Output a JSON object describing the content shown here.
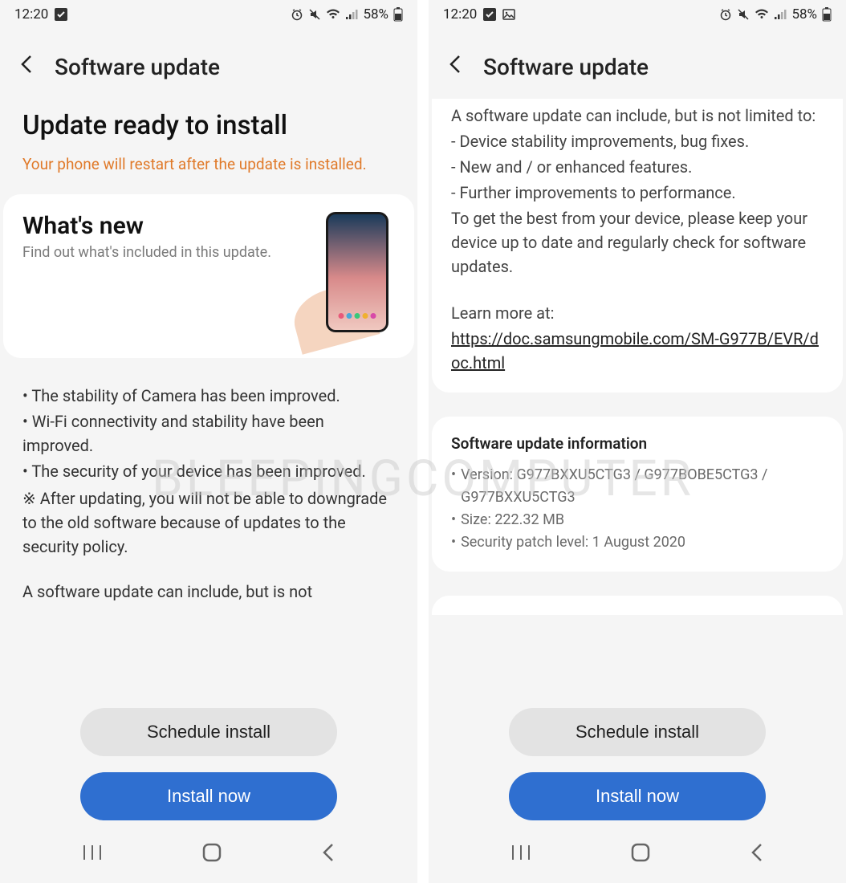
{
  "status": {
    "time": "12:20",
    "battery_pct": "58%"
  },
  "header": {
    "title": "Software update"
  },
  "screen1": {
    "title": "Update ready to install",
    "warning": "Your phone will restart after the update is installed.",
    "whats_new_title": "What's new",
    "whats_new_sub": "Find out what's included in this update.",
    "bullets": {
      "b1": "• The stability of Camera has been improved.",
      "b2": "• Wi-Fi connectivity and stability have been improved.",
      "b3": "• The security of your device has been improved.",
      "note": "※ After updating, you will not be able to downgrade to the old software because of updates to the security policy.",
      "continuing": "A software update can include, but is not"
    }
  },
  "screen2": {
    "intro": "A software update can include, but is not limited to:",
    "items": {
      "i1": " - Device stability improvements, bug fixes.",
      "i2": " - New and / or enhanced features.",
      "i3": " - Further improvements to performance."
    },
    "outro": "To get the best from your device, please keep your device up to date and regularly check for software updates.",
    "learn_label": "Learn more at:",
    "learn_link": "https://doc.samsungmobile.com/SM-G977B/EVR/doc.html",
    "info_title": "Software update information",
    "version_label": "Version: ",
    "version": "G977BXXU5CTG3 / G977BOBE5CTG3 / G977BXXU5CTG3",
    "size_label": "Size: ",
    "size": "222.32 MB",
    "patch_label": "Security patch level: ",
    "patch": "1 August 2020"
  },
  "buttons": {
    "schedule": "Schedule install",
    "install": "Install now"
  },
  "watermark": "BLEEPINGCOMPUTER"
}
